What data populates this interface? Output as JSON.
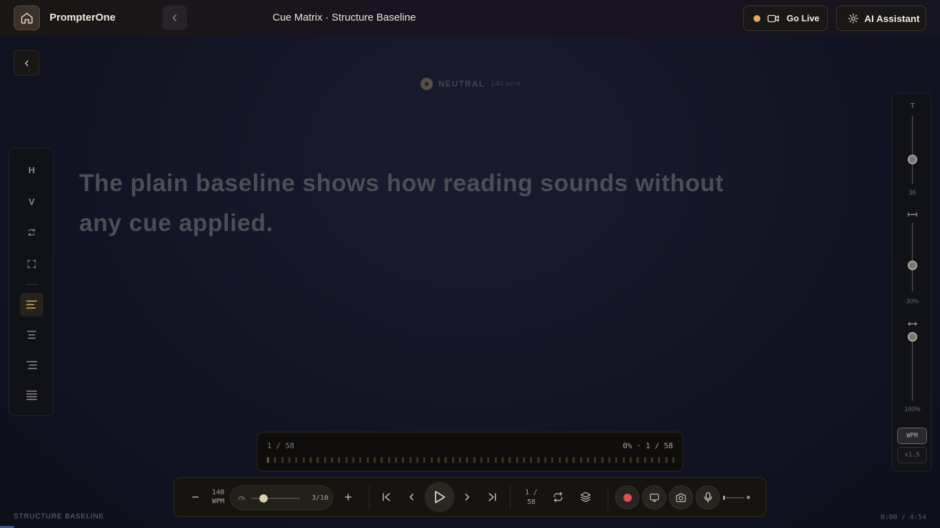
{
  "header": {
    "brand": "PrompterOne",
    "doc_title": "Cue Matrix · Structure Baseline",
    "go_live_label": "Go Live",
    "ai_label": "AI Assistant"
  },
  "emotion": {
    "label": "NEUTRAL",
    "wpm_value": "140",
    "wpm_unit": "WPM"
  },
  "left_toolbar": {
    "items": [
      {
        "label": "H"
      },
      {
        "label": "V"
      }
    ]
  },
  "reading": {
    "text": "The plain baseline shows how reading sounds without any cue applied."
  },
  "right_panel": {
    "font_icon": "T",
    "font_size": "36",
    "focus_value": "30%",
    "width_value": "100%",
    "wpm_button": "WPM",
    "speed_button": "x1.5"
  },
  "progress": {
    "left": "1 / 58",
    "right": "0% · 1 / 58",
    "percent": 0
  },
  "controls": {
    "wpm_value": "140",
    "wpm_unit": "WPM",
    "speed_value": "3/10",
    "page_current": "1 /",
    "page_total": "58"
  },
  "footer": {
    "label": "STRUCTURE BASELINE",
    "time": "0:00 / 4:54"
  },
  "colors": {
    "accent": "#e0a95c",
    "record": "#e05252",
    "background": "#121322"
  }
}
